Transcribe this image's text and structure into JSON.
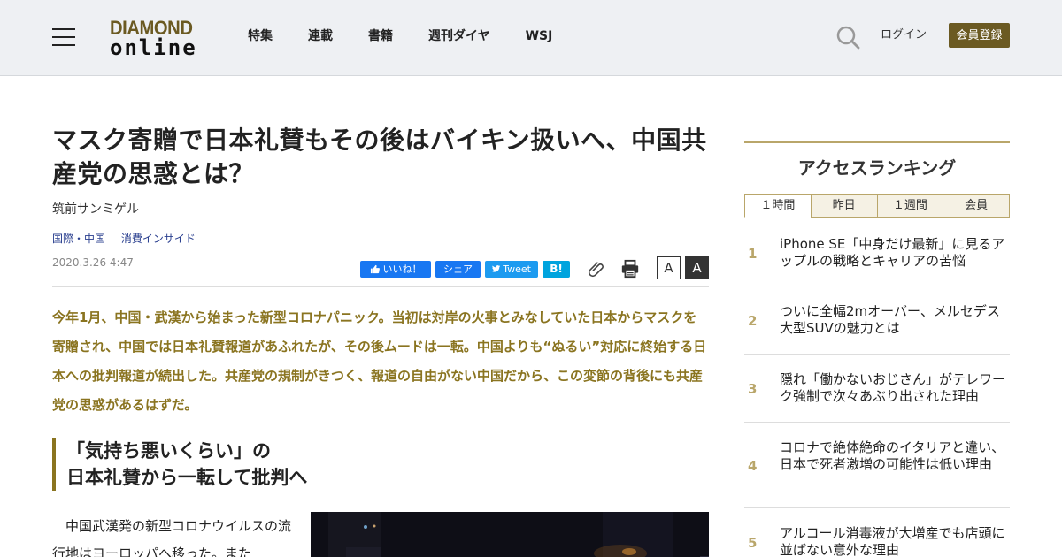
{
  "header": {
    "logo_top": "DIAMOND",
    "logo_bottom": "online",
    "nav": [
      "特集",
      "連載",
      "書籍",
      "週刊ダイヤ",
      "WSJ"
    ],
    "login": "ログイン",
    "register": "会員登録",
    "icons": [
      "menu-icon",
      "search-icon"
    ]
  },
  "article": {
    "title": "マスク寄贈で日本礼賛もその後はバイキン扱いへ、中国共産党の思惑とは？",
    "author": "筑前サンミゲル",
    "categories": [
      "国際・中国",
      "消費インサイド"
    ],
    "date": "2020.3.26 4:47",
    "share": {
      "like": "いいね！",
      "share": "シェア",
      "tweet": "Tweet",
      "hatena": "B!"
    },
    "font_small": "A",
    "font_large": "A",
    "lead": "今年1月、中国・武漢から始まった新型コロナパニック。当初は対岸の火事とみなしていた日本からマスクを寄贈され、中国では日本礼賛報道があふれたが、その後ムードは一転。中国よりも“ぬるい”対応に終始する日本への批判報道が続出した。共産党の規制がきつく、報道の自由がない中国だから、この変節の背後にも共産党の思惑があるはずだ。",
    "section_head_1": "「気持ち悪いくらい」の",
    "section_head_2": "日本礼賛から一転して批判へ",
    "body": "中国武漢発の新型コロナウイルスの流行地はヨーロッパへ移った。また"
  },
  "sidebar": {
    "title": "アクセスランキング",
    "tabs": [
      "１時間",
      "昨日",
      "１週間",
      "会員"
    ],
    "active_tab": "１時間",
    "ranking": [
      {
        "rank": "1",
        "text": "iPhone SE「中身だけ最新」に見るアップルの戦略とキャリアの苦悩"
      },
      {
        "rank": "2",
        "text": "ついに全幅2mオーバー、メルセデス大型SUVの魅力とは"
      },
      {
        "rank": "3",
        "text": "隠れ「働かないおじさん」がテレワーク強制で次々あぶり出された理由"
      },
      {
        "rank": "4",
        "text": "コロナで絶体絶命のイタリアと違い、日本で死者激増の可能性は低い理由"
      },
      {
        "rank": "5",
        "text": "アルコール消毒液が大増産でも店頭に並ばない意外な理由"
      }
    ]
  },
  "colors": {
    "brand_gold": "#6b5a22",
    "lead_text": "#8a7420",
    "rank_number": "#b9a66a",
    "header_bg": "#eef0f3"
  }
}
